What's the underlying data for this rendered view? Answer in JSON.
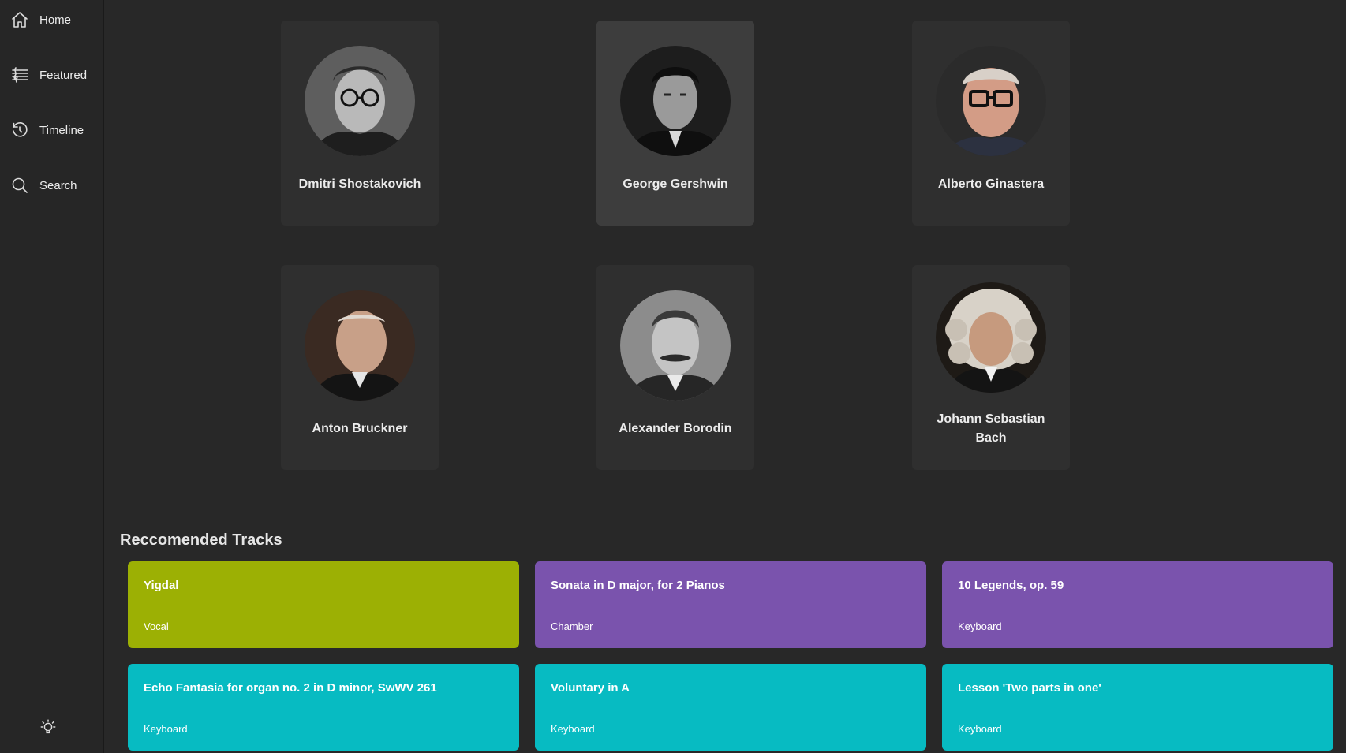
{
  "nav": {
    "items": [
      {
        "label": "Home",
        "icon": "home-icon"
      },
      {
        "label": "Featured",
        "icon": "music-staff-icon"
      },
      {
        "label": "Timeline",
        "icon": "history-icon"
      },
      {
        "label": "Search",
        "icon": "search-icon"
      }
    ],
    "theme_icon": "lightbulb-icon"
  },
  "composers": [
    {
      "name": "Dmitri Shostakovich"
    },
    {
      "name": "George Gershwin"
    },
    {
      "name": "Alberto Ginastera"
    },
    {
      "name": "Anton Bruckner"
    },
    {
      "name": "Alexander Borodin"
    },
    {
      "name": "Johann Sebastian Bach"
    }
  ],
  "recommended": {
    "title": "Reccomended Tracks",
    "tracks": [
      {
        "title": "Yigdal",
        "genre": "Vocal",
        "color": "#9cb004"
      },
      {
        "title": "Sonata in D major, for 2 Pianos",
        "genre": "Chamber",
        "color": "#7a53ad"
      },
      {
        "title": "10 Legends, op. 59",
        "genre": "Keyboard",
        "color": "#7a53ad"
      },
      {
        "title": "Echo Fantasia for organ no. 2 in D minor, SwWV 261",
        "genre": "Keyboard",
        "color": "#07bbc2"
      },
      {
        "title": "Voluntary in A",
        "genre": "Keyboard",
        "color": "#07bbc2"
      },
      {
        "title": "Lesson 'Two parts in one'",
        "genre": "Keyboard",
        "color": "#07bbc2"
      }
    ]
  },
  "colors": {
    "background": "#282828",
    "card": "#2f2f2f",
    "card_hover": "#3d3d3d",
    "vocal": "#9cb004",
    "chamber": "#7a53ad",
    "keyboard": "#07bbc2"
  }
}
